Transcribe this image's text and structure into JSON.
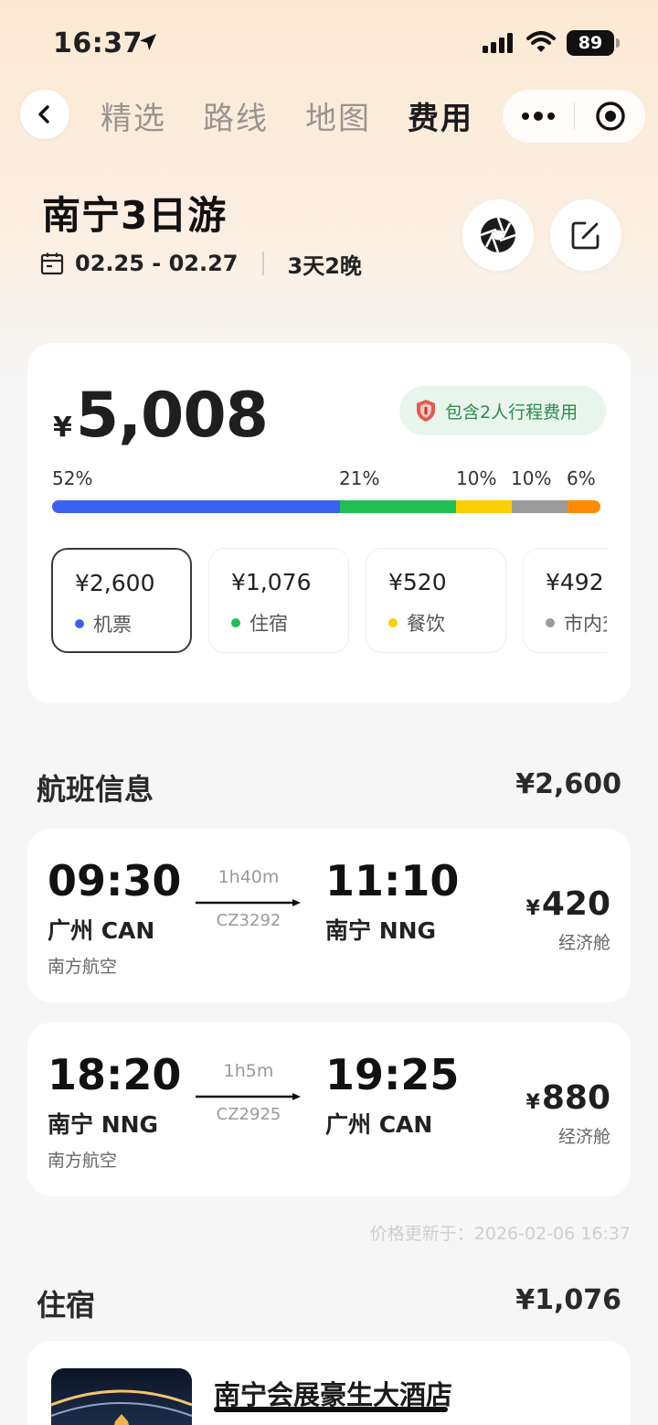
{
  "status": {
    "time": "16:37",
    "battery": "89"
  },
  "nav": {
    "tabs": [
      {
        "label": "精选"
      },
      {
        "label": "路线"
      },
      {
        "label": "地图"
      },
      {
        "label": "费用"
      }
    ],
    "active_tab": "费用"
  },
  "trip": {
    "title": "南宁3日游",
    "dates": "02.25 - 02.27",
    "duration": "3天2晚"
  },
  "cost": {
    "currency": "¥",
    "total": "5,008",
    "includes": "包含2人行程费用",
    "breakdown": [
      {
        "pct_label": "52%",
        "share": 52,
        "color": "#3b62ee"
      },
      {
        "pct_label": "21%",
        "share": 21,
        "color": "#1fbf55"
      },
      {
        "pct_label": "10%",
        "share": 10,
        "color": "#fbd000"
      },
      {
        "pct_label": "10%",
        "share": 10,
        "color": "#9b9b9b"
      },
      {
        "pct_label": "6%",
        "share": 6,
        "color": "#ff8c00"
      }
    ],
    "categories": [
      {
        "value": "¥2,600",
        "label": "机票",
        "color": "#3b62ee"
      },
      {
        "value": "¥1,076",
        "label": "住宿",
        "color": "#1fbf55"
      },
      {
        "value": "¥520",
        "label": "餐饮",
        "color": "#fbd000"
      },
      {
        "value": "¥492",
        "label": "市内交",
        "color": "#9b9b9b"
      }
    ]
  },
  "flights_section": {
    "title": "航班信息",
    "total": "¥2,600",
    "flights": [
      {
        "dep_time": "09:30",
        "dep_city": "广州 CAN",
        "arr_time": "11:10",
        "arr_city": "南宁 NNG",
        "duration": "1h40m",
        "flight_no": "CZ3292",
        "airline": "南方航空",
        "currency": "¥",
        "price": "420",
        "cabin": "经济舱"
      },
      {
        "dep_time": "18:20",
        "dep_city": "南宁 NNG",
        "arr_time": "19:25",
        "arr_city": "广州 CAN",
        "duration": "1h5m",
        "flight_no": "CZ2925",
        "airline": "南方航空",
        "currency": "¥",
        "price": "880",
        "cabin": "经济舱"
      }
    ],
    "updated": "价格更新于：2026-02-06 16:37"
  },
  "hotel_section": {
    "title": "住宿",
    "total": "¥1,076",
    "hotel_name": "南宁会展豪生大酒店"
  }
}
